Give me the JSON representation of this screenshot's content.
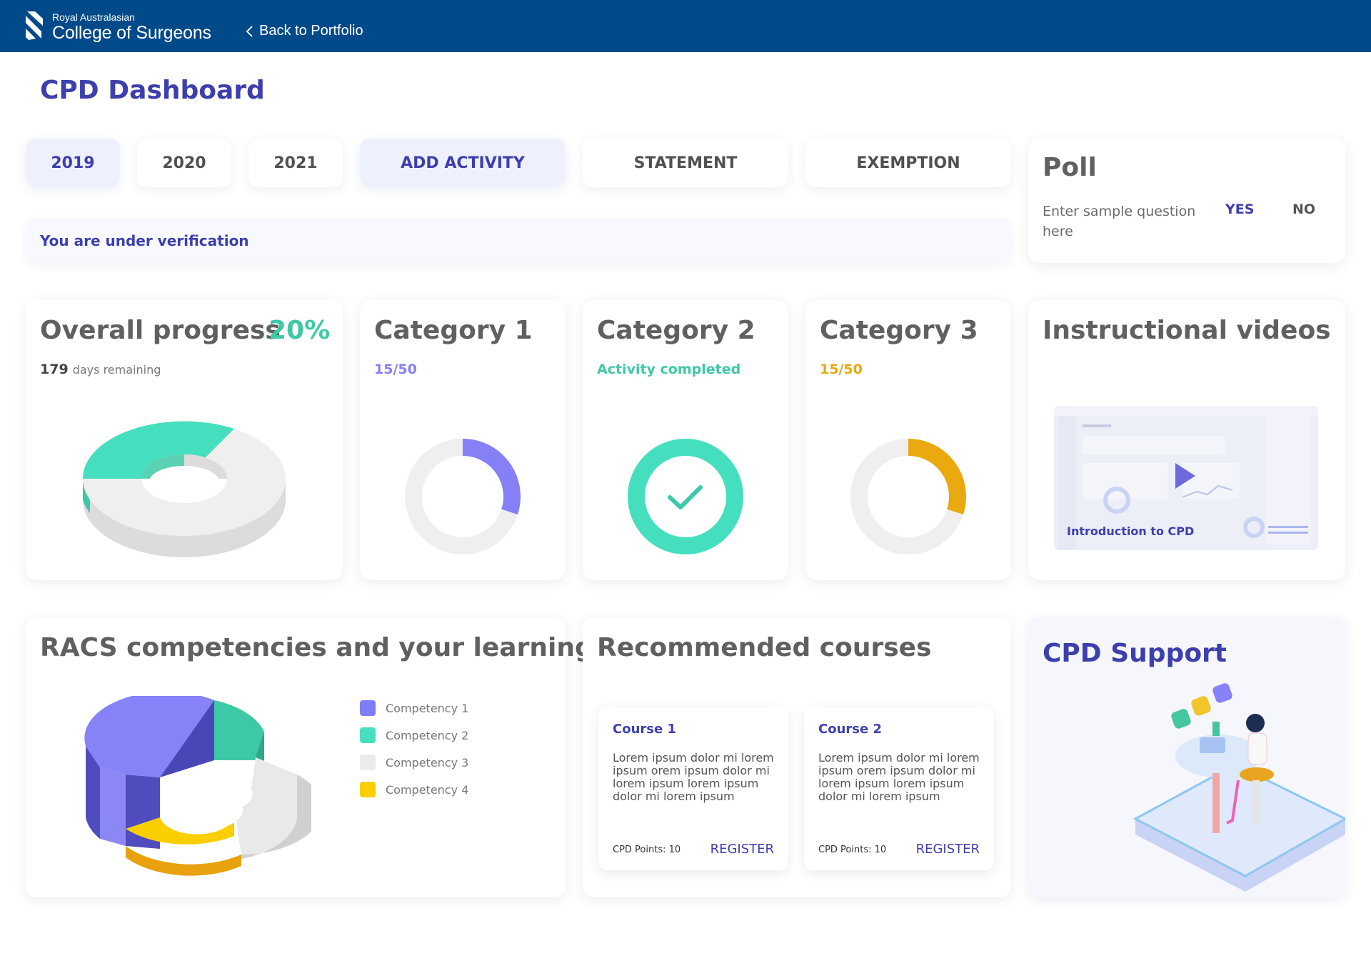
{
  "header": {
    "org_small": "Royal Australasian",
    "org_big": "College of Surgeons",
    "back_label": "Back to Portfolio"
  },
  "page_title": "CPD Dashboard",
  "tabs": [
    {
      "label": "2019",
      "active": true
    },
    {
      "label": "2020",
      "active": false
    },
    {
      "label": "2021",
      "active": false
    },
    {
      "label": "ADD ACTIVITY",
      "active": true
    },
    {
      "label": "STATEMENT",
      "active": false
    },
    {
      "label": "EXEMPTION",
      "active": false
    }
  ],
  "verification_message": "You are under verification",
  "poll": {
    "title": "Poll",
    "question": "Enter sample question here",
    "yes": "YES",
    "no": "NO"
  },
  "overall": {
    "title": "Overall progress",
    "percent_label": "20%",
    "days": "179",
    "days_suffix": "days remaining",
    "progress": 0.2
  },
  "categories": [
    {
      "title": "Category 1",
      "status": "15/50",
      "color": "#8580f5",
      "progress": 0.3
    },
    {
      "title": "Category 2",
      "status": "Activity completed",
      "color": "#45dfbf",
      "progress": 1.0
    },
    {
      "title": "Category 3",
      "status": "15/50",
      "color": "#e9a90f",
      "progress": 0.3
    }
  ],
  "videos": {
    "title": "Instructional videos",
    "video_label": "Introduction to CPD"
  },
  "competencies": {
    "title": "RACS competencies and your learning",
    "legend": [
      {
        "label": "Competency 1",
        "color": "#7f7cf5"
      },
      {
        "label": "Competency 2",
        "color": "#45dfbf"
      },
      {
        "label": "Competency 3",
        "color": "#ececec"
      },
      {
        "label": "Competency 4",
        "color": "#f9cf00"
      }
    ]
  },
  "courses": {
    "title": "Recommended courses",
    "items": [
      {
        "title": "Course 1",
        "body": "Lorem ipsum dolor mi lorem ipsum orem ipsum dolor mi lorem ipsum lorem ipsum dolor mi lorem ipsum",
        "points": "CPD Points: 10",
        "register": "REGISTER"
      },
      {
        "title": "Course 2",
        "body": "Lorem ipsum dolor mi lorem ipsum orem ipsum dolor mi lorem ipsum lorem ipsum dolor mi lorem ipsum",
        "points": "CPD Points: 10",
        "register": "REGISTER"
      }
    ]
  },
  "support": {
    "title": "CPD Support"
  }
}
